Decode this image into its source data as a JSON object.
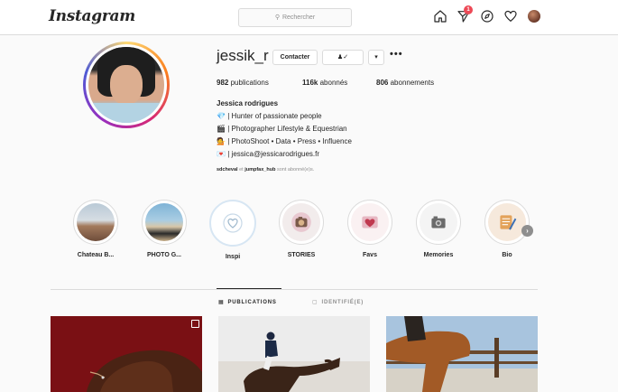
{
  "header": {
    "logo_text": "Instagram",
    "search_placeholder": "Rechercher",
    "notification_count": "1",
    "icons": [
      "home-icon",
      "direct-message-icon",
      "explore-icon",
      "heart-icon",
      "profile-avatar"
    ]
  },
  "profile": {
    "username": "jessik_r",
    "contact_label": "Contacter",
    "follow_glyph": "♟✓",
    "dropdown_glyph": "▾",
    "more_glyph": "•••",
    "stats": {
      "posts_count": "982",
      "posts_label": "publications",
      "followers_count": "116k",
      "followers_label": "abonnés",
      "following_count": "806",
      "following_label": "abonnements"
    },
    "full_name": "Jessica rodrigues",
    "bio": [
      {
        "emoji": "💎",
        "text": "| Hunter of passionate people"
      },
      {
        "emoji": "🎬",
        "text": "| Photographer Lifestyle & Equestrian"
      },
      {
        "emoji": "💁",
        "text": "| PhotoShoot • Data • Press • Influence"
      },
      {
        "emoji": "💌",
        "text": "| jessica@jessicarodrigues.fr"
      }
    ],
    "followed_by_user1": "sdcheval",
    "followed_by_joiner": "et",
    "followed_by_user2": "jumpfax_hub",
    "followed_by_suffix": "sont abonné(e)s."
  },
  "highlights": [
    {
      "label": "Chateau B..."
    },
    {
      "label": "PHOTO G..."
    },
    {
      "label": "Inspi"
    },
    {
      "label": "STORIES"
    },
    {
      "label": "Favs"
    },
    {
      "label": "Memories"
    },
    {
      "label": "Bio"
    }
  ],
  "tabs": {
    "publications": "PUBLICATIONS",
    "tagged": "IDENTIFIÉ(E)"
  },
  "colors": {
    "accent_blue": "#0095f6",
    "notification_red": "#ed4956",
    "border": "#dbdbdb",
    "background": "#fafafa"
  }
}
